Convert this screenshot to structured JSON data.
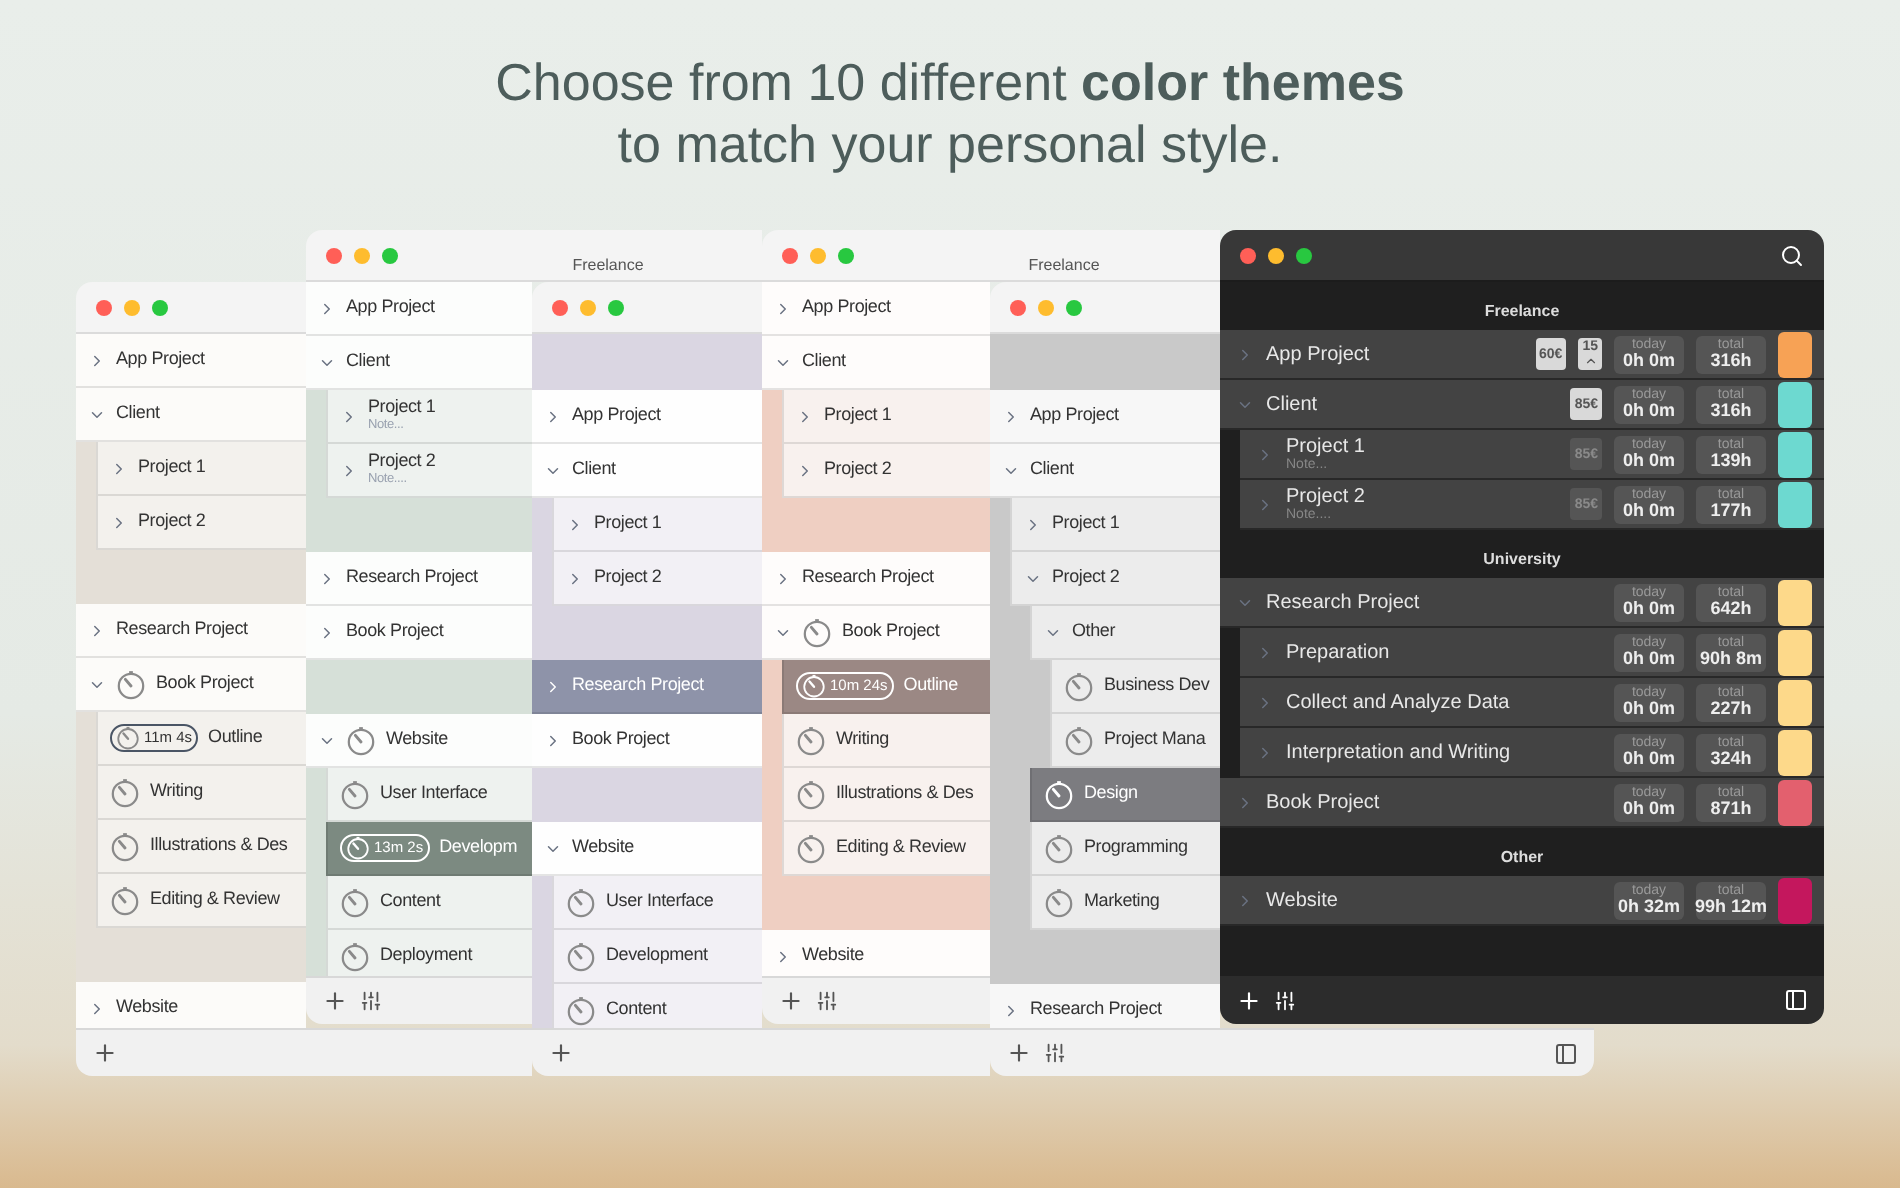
{
  "headline": [
    "Choose from 10 different **color themes**",
    "to match your personal style."
  ],
  "windows": [
    {
      "kind": "light",
      "top_gap": false,
      "show_filter": false,
      "show_sidebar": false,
      "sections": [
        {
          "rows": [
            {
              "label": "App Project",
              "kind": "project",
              "expanded": false,
              "selected": false
            },
            {
              "label": "Client",
              "kind": "project",
              "expanded": true,
              "selected": false,
              "children": [
                {
                  "label": "Project 1",
                  "kind": "project",
                  "expanded": false,
                  "selected": false
                },
                {
                  "label": "Project 2",
                  "kind": "project",
                  "expanded": false,
                  "selected": false
                }
              ]
            }
          ]
        },
        {
          "rows": [
            {
              "label": "Research Project",
              "kind": "project",
              "expanded": false,
              "selected": false
            },
            {
              "label": "Book Project",
              "kind": "timed_project",
              "expanded": true,
              "selected": false,
              "children": [
                {
                  "label": "Outline",
                  "kind": "task",
                  "selected": false,
                  "timer": "11m 4s"
                },
                {
                  "label": "Writing",
                  "kind": "task",
                  "selected": false
                },
                {
                  "label": "Illustrations & Des",
                  "kind": "task",
                  "selected": false
                },
                {
                  "label": "Editing & Review",
                  "kind": "task",
                  "selected": false
                }
              ]
            }
          ]
        },
        {
          "rows": [
            {
              "label": "Website",
              "kind": "project",
              "expanded": false,
              "selected": false
            }
          ]
        }
      ]
    },
    {
      "kind": "light",
      "title": "Freelance",
      "top_gap": false,
      "show_filter": true,
      "show_sidebar": false,
      "sections": [
        {
          "rows": [
            {
              "label": "App Project",
              "kind": "project",
              "expanded": false,
              "selected": false
            },
            {
              "label": "Client",
              "kind": "project",
              "expanded": true,
              "selected": false,
              "children": [
                {
                  "label": "Project 1",
                  "note": "Note...",
                  "kind": "project",
                  "expanded": false,
                  "selected": false
                },
                {
                  "label": "Project 2",
                  "note": "Note....",
                  "kind": "project",
                  "expanded": false,
                  "selected": false
                }
              ]
            }
          ]
        },
        {
          "rows": [
            {
              "label": "Research Project",
              "kind": "project",
              "expanded": false,
              "selected": false
            },
            {
              "label": "Book Project",
              "kind": "project",
              "expanded": false,
              "selected": false
            }
          ]
        },
        {
          "rows": [
            {
              "label": "Website",
              "kind": "timed_project",
              "expanded": true,
              "selected": false,
              "children": [
                {
                  "label": "User Interface",
                  "kind": "task",
                  "selected": false
                },
                {
                  "label": "Developm",
                  "kind": "task",
                  "selected": true,
                  "timer": "13m 2s"
                },
                {
                  "label": "Content",
                  "kind": "task",
                  "selected": false
                },
                {
                  "label": "Deployment",
                  "kind": "task",
                  "selected": false
                }
              ]
            }
          ]
        }
      ]
    },
    {
      "kind": "light",
      "top_gap": true,
      "show_filter": false,
      "show_sidebar": false,
      "sections": [
        {
          "rows": [
            {
              "label": "App Project",
              "kind": "project",
              "expanded": false,
              "selected": false
            },
            {
              "label": "Client",
              "kind": "project",
              "expanded": true,
              "selected": false,
              "children": [
                {
                  "label": "Project 1",
                  "kind": "project",
                  "expanded": false,
                  "selected": false
                },
                {
                  "label": "Project 2",
                  "kind": "project",
                  "expanded": false,
                  "selected": false
                }
              ]
            }
          ]
        },
        {
          "rows": [
            {
              "label": "Research Project",
              "kind": "project",
              "expanded": false,
              "selected": true
            },
            {
              "label": "Book Project",
              "kind": "project",
              "expanded": false,
              "selected": false
            }
          ]
        },
        {
          "rows": [
            {
              "label": "Website",
              "kind": "project",
              "expanded": true,
              "selected": false,
              "children": [
                {
                  "label": "User Interface",
                  "kind": "task",
                  "selected": false
                },
                {
                  "label": "Development",
                  "kind": "task",
                  "selected": false
                },
                {
                  "label": "Content",
                  "kind": "task",
                  "selected": false
                }
              ]
            }
          ]
        }
      ]
    },
    {
      "kind": "light",
      "title": "Freelance",
      "top_gap": false,
      "show_filter": true,
      "show_sidebar": false,
      "sections": [
        {
          "rows": [
            {
              "label": "App Project",
              "kind": "project",
              "expanded": false,
              "selected": false
            },
            {
              "label": "Client",
              "kind": "project",
              "expanded": true,
              "selected": false,
              "children": [
                {
                  "label": "Project 1",
                  "kind": "project",
                  "expanded": false,
                  "selected": false
                },
                {
                  "label": "Project 2",
                  "kind": "project",
                  "expanded": false,
                  "selected": false
                }
              ]
            }
          ]
        },
        {
          "rows": [
            {
              "label": "Research Project",
              "kind": "project",
              "expanded": false,
              "selected": false
            },
            {
              "label": "Book Project",
              "kind": "timed_project",
              "expanded": true,
              "selected": false,
              "children": [
                {
                  "label": "Outline",
                  "kind": "task",
                  "selected": true,
                  "timer": "10m 24s"
                },
                {
                  "label": "Writing",
                  "kind": "task",
                  "selected": false
                },
                {
                  "label": "Illustrations & Des",
                  "kind": "task",
                  "selected": false
                },
                {
                  "label": "Editing & Review",
                  "kind": "task",
                  "selected": false
                }
              ]
            }
          ]
        },
        {
          "rows": [
            {
              "label": "Website",
              "kind": "project",
              "expanded": false,
              "selected": false
            }
          ]
        }
      ]
    },
    {
      "kind": "light",
      "top_gap": true,
      "show_filter": true,
      "show_sidebar": true,
      "sections": [
        {
          "rows": [
            {
              "label": "App Project",
              "kind": "project",
              "expanded": false,
              "selected": false
            },
            {
              "label": "Client",
              "kind": "project",
              "expanded": true,
              "selected": false,
              "children": [
                {
                  "label": "Project 1",
                  "kind": "project",
                  "expanded": false,
                  "selected": false
                },
                {
                  "label": "Project 2",
                  "kind": "project",
                  "expanded": true,
                  "selected": false,
                  "children": [
                    {
                      "label": "Other",
                      "kind": "project",
                      "expanded": true,
                      "selected": false,
                      "children": [
                        {
                          "label": "Business Dev",
                          "kind": "task",
                          "selected": false
                        },
                        {
                          "label": "Project Mana",
                          "kind": "task",
                          "selected": false
                        }
                      ]
                    },
                    {
                      "label": "Design",
                      "kind": "task",
                      "selected": true
                    },
                    {
                      "label": "Programming",
                      "kind": "task",
                      "selected": false
                    },
                    {
                      "label": "Marketing",
                      "kind": "task",
                      "selected": false
                    }
                  ]
                }
              ]
            }
          ]
        },
        {
          "rows": [
            {
              "label": "Research Project",
              "kind": "project",
              "expanded": false,
              "selected": false
            }
          ]
        }
      ]
    },
    {
      "kind": "dark",
      "top_gap": false,
      "show_filter": true,
      "show_sidebar": true,
      "sections": [
        {
          "header": "Freelance",
          "rows": [
            {
              "label": "App Project",
              "expanded": false,
              "badges": [
                {
                  "text": "60€",
                  "inherited": false
                },
                {
                  "text": "15",
                  "inherited": false,
                  "caret": true
                }
              ],
              "today": {
                "label": "today",
                "value": "0h 0m"
              },
              "total": {
                "label": "total",
                "value": "316h"
              },
              "color": "#f7a255"
            },
            {
              "label": "Client",
              "expanded": true,
              "badges": [
                {
                  "text": "85€",
                  "inherited": false
                }
              ],
              "today": {
                "label": "today",
                "value": "0h 0m"
              },
              "total": {
                "label": "total",
                "value": "316h"
              },
              "color": "#6dd9d0",
              "children": [
                {
                  "label": "Project 1",
                  "note": "Note...",
                  "expanded": false,
                  "badges": [
                    {
                      "text": "85€",
                      "inherited": true
                    }
                  ],
                  "today": {
                    "label": "today",
                    "value": "0h 0m"
                  },
                  "total": {
                    "label": "total",
                    "value": "139h"
                  },
                  "color": "#6dd9d0"
                },
                {
                  "label": "Project 2",
                  "note": "Note....",
                  "expanded": false,
                  "badges": [
                    {
                      "text": "85€",
                      "inherited": true
                    }
                  ],
                  "today": {
                    "label": "today",
                    "value": "0h 0m"
                  },
                  "total": {
                    "label": "total",
                    "value": "177h"
                  },
                  "color": "#6dd9d0"
                }
              ]
            }
          ]
        },
        {
          "header": "University",
          "rows": [
            {
              "label": "Research Project",
              "expanded": true,
              "today": {
                "label": "today",
                "value": "0h 0m"
              },
              "total": {
                "label": "total",
                "value": "642h"
              },
              "color": "#fdd98a",
              "children": [
                {
                  "label": "Preparation",
                  "expanded": false,
                  "today": {
                    "label": "today",
                    "value": "0h 0m"
                  },
                  "total": {
                    "label": "total",
                    "value": "90h 8m"
                  },
                  "color": "#fdd98a"
                },
                {
                  "label": "Collect and Analyze Data",
                  "expanded": false,
                  "today": {
                    "label": "today",
                    "value": "0h 0m"
                  },
                  "total": {
                    "label": "total",
                    "value": "227h"
                  },
                  "color": "#fdd98a"
                },
                {
                  "label": "Interpretation and Writing",
                  "expanded": false,
                  "today": {
                    "label": "today",
                    "value": "0h 0m"
                  },
                  "total": {
                    "label": "total",
                    "value": "324h"
                  },
                  "color": "#fdd98a"
                }
              ]
            },
            {
              "label": "Book Project",
              "expanded": false,
              "today": {
                "label": "today",
                "value": "0h 0m"
              },
              "total": {
                "label": "total",
                "value": "871h"
              },
              "color": "#e3606e"
            }
          ]
        },
        {
          "header": "Other",
          "rows": [
            {
              "label": "Website",
              "expanded": false,
              "today": {
                "label": "today",
                "value": "0h 32m"
              },
              "total": {
                "label": "total",
                "value": "99h 12m"
              },
              "color": "#c4175d"
            }
          ]
        }
      ]
    }
  ]
}
